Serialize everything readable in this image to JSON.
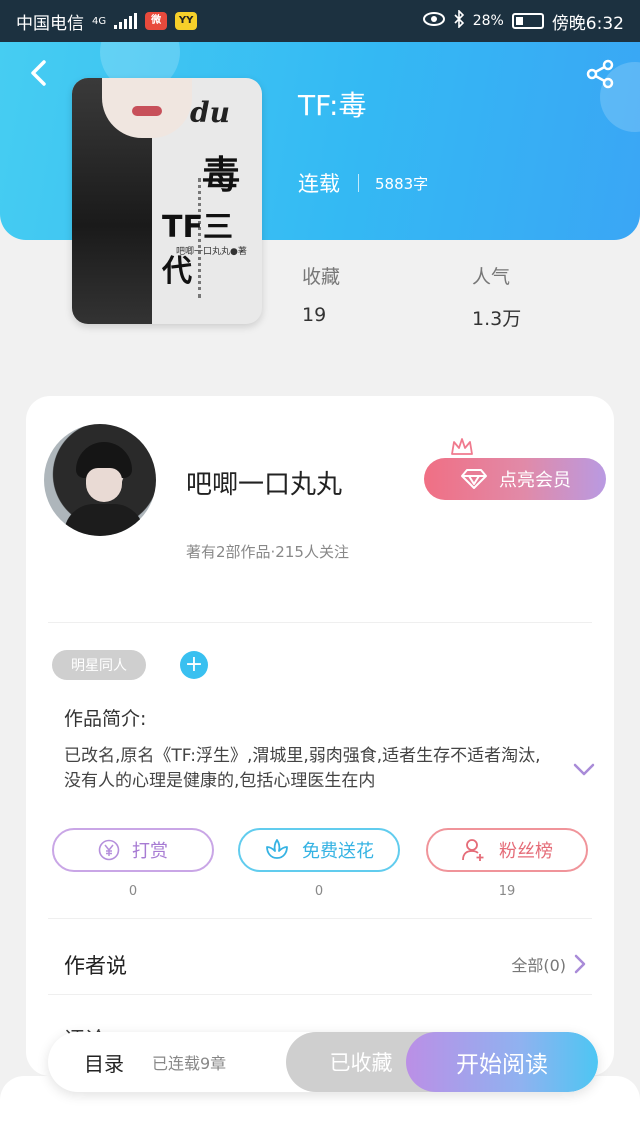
{
  "status_bar": {
    "carrier": "中国电信",
    "network": "4G",
    "battery": "28%",
    "time": "傍晚6:32"
  },
  "book": {
    "title": "TF:毒",
    "status": "连载",
    "word_count": "5883字",
    "cover_text": {
      "line1": "du",
      "line2": "毒",
      "line3": "TF三代",
      "line4": "吧唧一口丸丸●著"
    },
    "stats": [
      {
        "label": "收藏",
        "value": "19"
      },
      {
        "label": "人气",
        "value": "1.3万"
      }
    ]
  },
  "author": {
    "name": "吧唧一口丸丸",
    "meta": "著有2部作品·215人关注",
    "vip_button": "点亮会员"
  },
  "tags": {
    "items": [
      "明星同人"
    ],
    "add_label": "+"
  },
  "intro": {
    "label": "作品简介:",
    "text": "已改名,原名《TF:浮生》,渭城里,弱肉强食,适者生存不适者淘汰,没有人的心理是健康的,包括心理医生在内"
  },
  "actions": [
    {
      "label": "打赏",
      "count": "0",
      "icon": "yuan-icon"
    },
    {
      "label": "免费送花",
      "count": "0",
      "icon": "flower-icon"
    },
    {
      "label": "粉丝榜",
      "count": "19",
      "icon": "fan-user-icon"
    }
  ],
  "author_says": {
    "title": "作者说",
    "right": "全部(0)"
  },
  "partial_row": {
    "title": "评论"
  },
  "bottom_bar": {
    "catalog": "目录",
    "chapter_count": "已连载9章",
    "collected": "已收藏",
    "start_reading": "开始阅读"
  },
  "colors": {
    "header_gradient_start": "#46cdf2",
    "header_gradient_end": "#3aa6f5",
    "vip_gradient": "#f06f84",
    "accent_blue": "#39c0f0",
    "accent_purple": "#bb8fe6"
  }
}
